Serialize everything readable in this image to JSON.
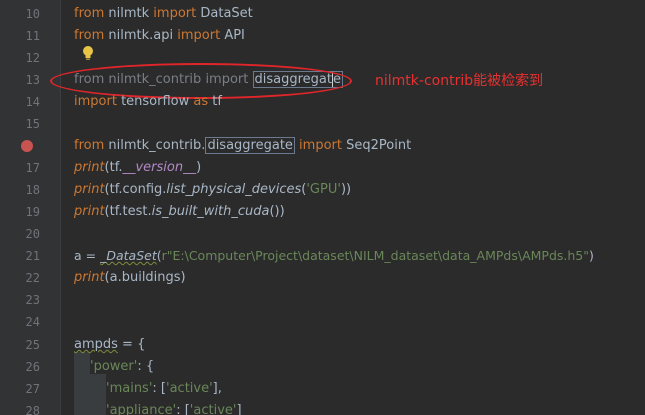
{
  "annotation": "nilmtk-contrib能被检索到",
  "colors": {
    "background": "#2b2b2b",
    "keyword": "#cc7832",
    "string": "#6a8759",
    "default_text": "#a9b7c6",
    "breakpoint": "#c75450",
    "annotation_red": "#e0262a"
  },
  "icons": {
    "bulb": "intention-bulb-icon",
    "breakpoint": "breakpoint-icon"
  },
  "lines": {
    "l10": {
      "num": "10",
      "kw1": "from",
      "mod": " nilmtk ",
      "kw2": "import",
      "name": " DataSet"
    },
    "l11": {
      "num": "11",
      "kw1": "from",
      "mod": " nilmtk.api ",
      "kw2": "import",
      "name": " API"
    },
    "l12": {
      "num": "12"
    },
    "l13": {
      "num": "13",
      "kw1": "from",
      "mod": " nilmtk_contrib ",
      "kw2": "import",
      "name_a": "disaggregat",
      "name_b": "e"
    },
    "l14": {
      "num": "14",
      "kw1": "import",
      "mod": " tensorflow ",
      "kw2": "as",
      "name": " tf"
    },
    "l15": {
      "num": "15"
    },
    "l16": {
      "num": "16",
      "kw1": "from",
      "mod": " nilmtk_contrib.",
      "mod2": "disaggregate",
      "kw2": " import",
      "name": " Seq2Point"
    },
    "l17": {
      "num": "17",
      "fn": "print",
      "p1": "(tf.",
      "attr": "__version__",
      "p2": ")"
    },
    "l18": {
      "num": "18",
      "fn": "print",
      "p1": "(tf.config.",
      "attr": "list_physical_devices",
      "p2": "(",
      "str": "'GPU'",
      "p3": "))"
    },
    "l19": {
      "num": "19",
      "fn": "print",
      "p1": "(tf.test.",
      "attr": "is_built_with_cuda",
      "p2": "())"
    },
    "l20": {
      "num": "20"
    },
    "l21": {
      "num": "21",
      "var": "a",
      "eq": " = ",
      "cls": "_DataSet",
      "p1": "(",
      "str": "r\"E:\\Computer\\Project\\dataset\\NILM_dataset\\data_AMPds\\AMPds.h5\"",
      "p2": ")"
    },
    "l22": {
      "num": "22",
      "fn": "print",
      "p1": "(a.buildings)"
    },
    "l23": {
      "num": "23"
    },
    "l24": {
      "num": "24"
    },
    "l25": {
      "num": "25",
      "var": "ampds",
      "rest": " = {"
    },
    "l26": {
      "num": "26",
      "str": "'power'",
      "rest": ": {"
    },
    "l27": {
      "num": "27",
      "str": "'mains'",
      "p1": ": [",
      "str2": "'active'",
      "p2": "],"
    },
    "l28": {
      "num": "28",
      "str": "'appliance'",
      "p1": ": [",
      "str2": "'active'",
      "p2": "]"
    }
  }
}
